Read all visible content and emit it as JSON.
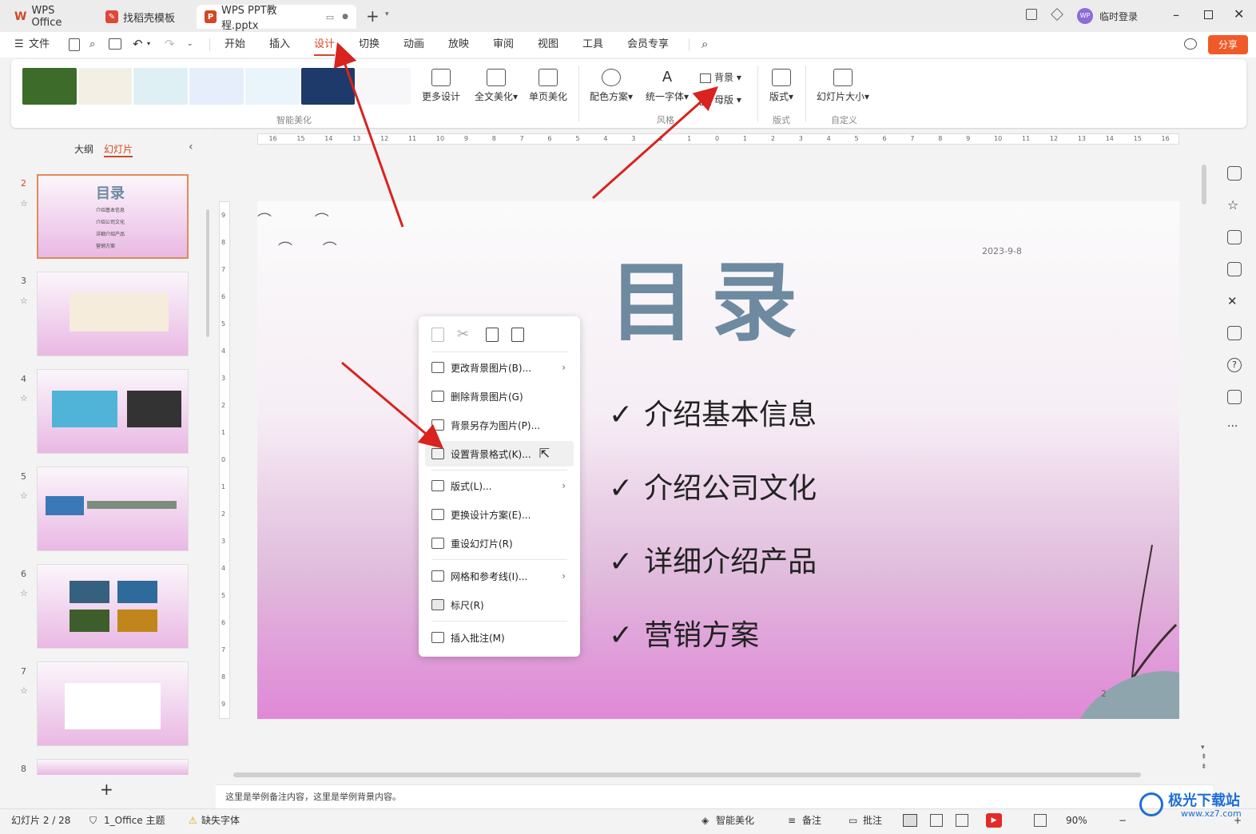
{
  "tabs": [
    {
      "label": "WPS Office"
    },
    {
      "label": "找稻壳模板"
    },
    {
      "label": "WPS PPT教程.pptx"
    }
  ],
  "titlebar": {
    "login": "临时登录",
    "avatar": "WP"
  },
  "menu": {
    "file": "文件",
    "items": [
      "开始",
      "插入",
      "设计",
      "切换",
      "动画",
      "放映",
      "审阅",
      "视图",
      "工具",
      "会员专享"
    ],
    "share": "分享"
  },
  "ribbon": {
    "more_design": "更多设计",
    "full_beautify": "全文美化",
    "single_beautify": "单页美化",
    "group_smart": "智能美化",
    "color_scheme": "配色方案",
    "unify_font": "统一字体",
    "background": "背景",
    "master": "母版",
    "group_style": "风格",
    "layout": "版式",
    "group_layout": "版式",
    "slide_size": "幻灯片大小",
    "group_custom": "自定义"
  },
  "pane": {
    "outline": "大纲",
    "slides": "幻灯片",
    "slide_numbers": [
      "2",
      "3",
      "4",
      "5",
      "6",
      "7",
      "8"
    ],
    "thumb_title": "目录",
    "thumb_items": [
      "介绍基本信息",
      "介绍公司文化",
      "详细介绍产品",
      "营销方案"
    ]
  },
  "ruler": {
    "labels": [
      "16",
      "15",
      "14",
      "13",
      "12",
      "11",
      "10",
      "9",
      "8",
      "7",
      "6",
      "5",
      "4",
      "3",
      "2",
      "1",
      "0",
      "1",
      "2",
      "3",
      "4",
      "5",
      "6",
      "7",
      "8",
      "9",
      "10",
      "11",
      "12",
      "13",
      "14",
      "15",
      "16"
    ],
    "vlabels": [
      "9",
      "8",
      "7",
      "6",
      "5",
      "4",
      "3",
      "2",
      "1",
      "0",
      "1",
      "2",
      "3",
      "4",
      "5",
      "6",
      "7",
      "8",
      "9"
    ]
  },
  "slide": {
    "title": "目录",
    "date": "2023-9-8",
    "items": [
      "介绍基本信息",
      "介绍公司文化",
      "详细介绍产品",
      "营销方案"
    ],
    "check": "✓",
    "page": "2"
  },
  "context_menu": {
    "items": [
      "更改背景图片(B)...",
      "删除背景图片(G)",
      "背景另存为图片(P)...",
      "设置背景格式(K)...",
      "版式(L)...",
      "更换设计方案(E)...",
      "重设幻灯片(R)",
      "网格和参考线(I)...",
      "标尺(R)",
      "插入批注(M)"
    ]
  },
  "notes": "这里是举例备注内容，这里是举例背景内容。",
  "status": {
    "slide_counter": "幻灯片 2 / 28",
    "theme": "1_Office 主题",
    "missing_font": "缺失字体",
    "smart": "智能美化",
    "notes": "备注",
    "comment": "批注",
    "zoom": "90%"
  },
  "watermark": {
    "name": "极光下载站",
    "url": "www.xz7.com"
  },
  "colors": {
    "accent": "#d24726",
    "title_color": "#6d8aa0",
    "arrow": "#d8231f"
  }
}
